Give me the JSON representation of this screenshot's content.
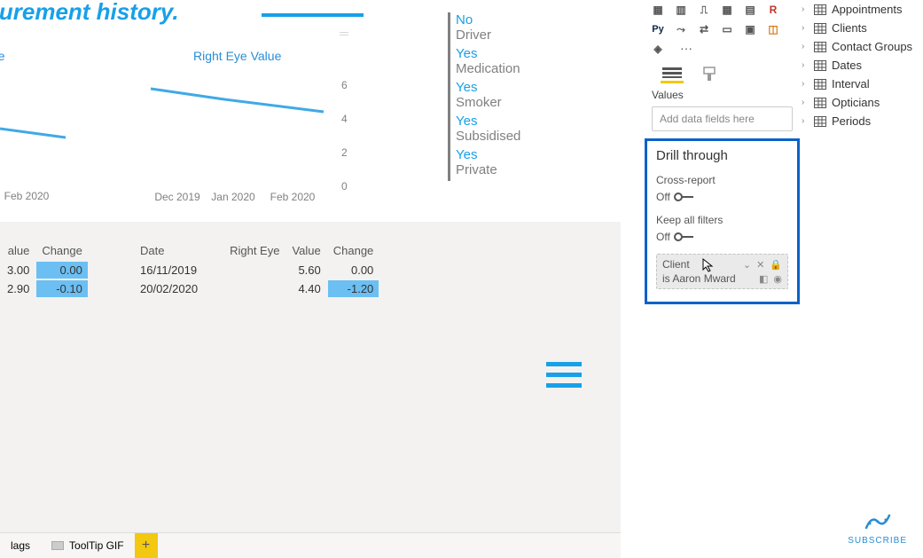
{
  "title": "nt eye measurement history.",
  "canvas": {
    "left_chart_title": "ue",
    "right_chart_title": "Right Eye Value"
  },
  "chart_data": [
    {
      "type": "line",
      "title": "ue",
      "x": [
        "Feb 2020"
      ],
      "values_fragment": true,
      "line_segment": [
        [
          0,
          2.0
        ],
        [
          74,
          2.3
        ]
      ]
    },
    {
      "type": "line",
      "title": "Right Eye Value",
      "x": [
        "Dec 2019",
        "Jan 2020",
        "Feb 2020"
      ],
      "ylim": [
        0,
        6
      ],
      "yticks": [
        0,
        2,
        4,
        6
      ],
      "series": [
        {
          "name": "Right Eye",
          "values": [
            5.6,
            5.0,
            4.4
          ]
        }
      ]
    }
  ],
  "slicer": [
    {
      "value": "No",
      "label": "Driver"
    },
    {
      "value": "Yes",
      "label": "Medication"
    },
    {
      "value": "Yes",
      "label": "Smoker"
    },
    {
      "value": "Yes",
      "label": "Subsidised"
    },
    {
      "value": "Yes",
      "label": "Private"
    }
  ],
  "table_left": {
    "headers": [
      "alue",
      "Change"
    ],
    "rows": [
      [
        "3.00",
        "0.00"
      ],
      [
        "2.90",
        "-0.10"
      ]
    ],
    "highlight_cells": [
      [
        0,
        1
      ],
      [
        1,
        1
      ]
    ]
  },
  "table_right": {
    "headers": [
      "Date",
      "Right Eye",
      "Value",
      "Change"
    ],
    "rows": [
      [
        "16/11/2019",
        "",
        "5.60",
        "0.00"
      ],
      [
        "20/02/2020",
        "",
        "4.40",
        "-1.20"
      ]
    ],
    "highlight_cells": [
      [
        1,
        3
      ]
    ]
  },
  "tabs": {
    "left_partial": "lags",
    "tooltip": "ToolTip GIF",
    "add": "+"
  },
  "viz": {
    "values_label": "Values",
    "well_placeholder": "Add data fields here",
    "drill_title": "Drill through",
    "cross_report": "Cross-report",
    "cross_report_state": "Off",
    "keep_filters": "Keep all filters",
    "keep_filters_state": "Off",
    "chip_name": "Client",
    "chip_filter": "is Aaron Mward"
  },
  "fields": [
    "Appointments",
    "Clients",
    "Contact Groups",
    "Dates",
    "Interval",
    "Opticians",
    "Periods"
  ],
  "subscribe": "SUBSCRIBE"
}
